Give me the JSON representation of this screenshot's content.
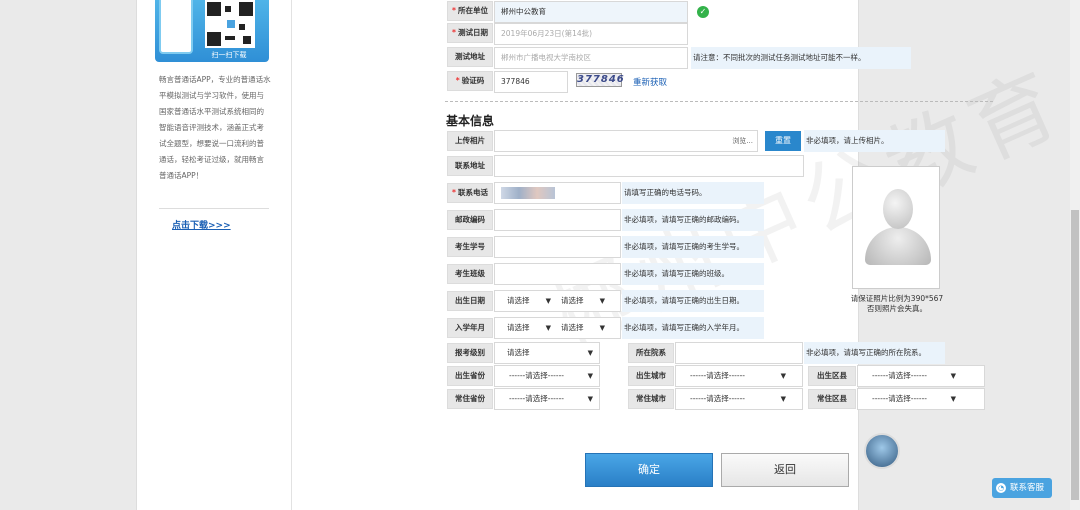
{
  "sidebar": {
    "scan_label": "扫一扫下载",
    "description": "畅言普通话APP，专业的普通话水平模拟测试与学习软件，使用与国家普通话水平测试系统相同的智能语音评测技术，涵盖正式考试全题型，想要说一口流利的普通话，轻松考证过级，就用畅言普通话APP！",
    "download_link": "点击下载>>>"
  },
  "exam_info": {
    "unit_label": "所在单位",
    "unit_value": "郴州中公教育",
    "date_label": "测试日期",
    "date_value": "2019年06月23日(第14批)",
    "address_label": "测试地址",
    "address_value": "郴州市广播电视大学南校区",
    "address_note": "请注意：不同批次的测试任务测试地址可能不一样。",
    "captcha_label": "验证码",
    "captcha_value": "377846",
    "captcha_image_text": "377846",
    "refresh_label": "重新获取"
  },
  "basic_info": {
    "title": "基本信息",
    "photo_label": "上传相片",
    "browse_label": "浏览...",
    "reset_label": "重置",
    "photo_hint": "非必填项，请上传相片。",
    "address_label": "联系地址",
    "phone_label": "联系电话",
    "phone_hint": "请填写正确的电话号码。",
    "zip_label": "邮政编码",
    "zip_hint": "非必填项，请填写正确的邮政编码。",
    "student_no_label": "考生学号",
    "student_no_hint": "非必填项，请填写正确的考生学号。",
    "class_label": "考生班级",
    "class_hint": "非必填项，请填写正确的班级。",
    "birth_label": "出生日期",
    "birth_year": "请选择",
    "birth_month": "请选择",
    "birth_hint": "非必填项，请填写正确的出生日期。",
    "enroll_label": "入学年月",
    "enroll_year": "请选择",
    "enroll_month": "请选择",
    "enroll_hint": "非必填项，请填写正确的入学年月。",
    "level_label": "报考级别",
    "level_value": "请选择",
    "dept_label": "所在院系",
    "dept_hint": "非必填项，请填写正确的所在院系。",
    "birth_province_label": "出生省份",
    "birth_province_value": "------请选择------",
    "birth_city_label": "出生城市",
    "birth_city_value": "------请选择------",
    "birth_district_label": "出生区县",
    "birth_district_value": "------请选择------",
    "home_province_label": "常住省份",
    "home_province_value": "------请选择------",
    "home_city_label": "常住城市",
    "home_city_value": "------请选择------",
    "home_district_label": "常住区县",
    "home_district_value": "------请选择------",
    "photo_note_line1": "请保证照片比例为390*567",
    "photo_note_line2": "否则照片会失真。"
  },
  "actions": {
    "confirm_label": "确定",
    "back_label": "返回"
  },
  "floating": {
    "service_label": "联系客服"
  },
  "watermark": "郴州中公教育",
  "colors": {
    "primary": "#2a87cc",
    "hint_bg": "#eaf3fb",
    "label_bg": "#e7e7e7",
    "required": "#e33333",
    "success": "#33b24a"
  }
}
